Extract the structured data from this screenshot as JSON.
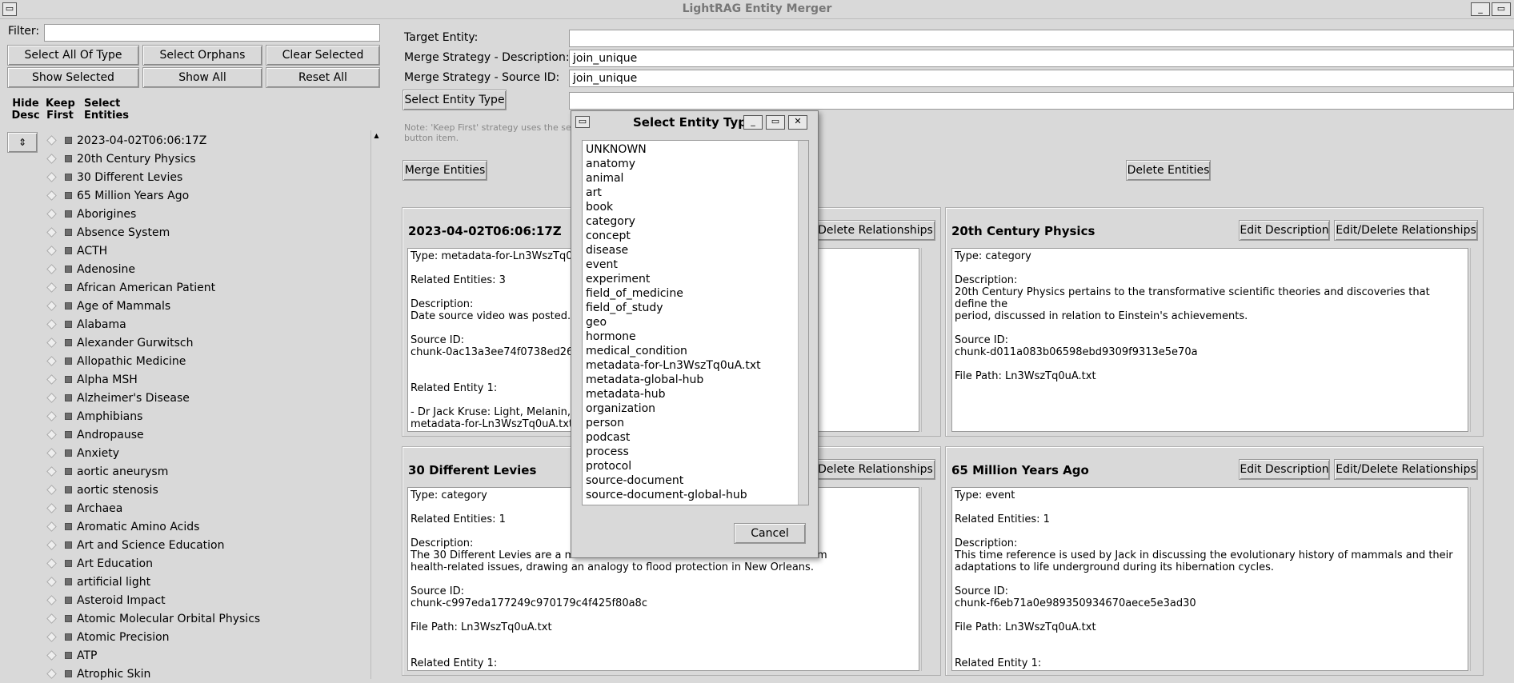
{
  "window": {
    "title": "LightRAG Entity Merger"
  },
  "filter": {
    "label": "Filter:",
    "value": ""
  },
  "left_buttons": {
    "select_all_of_type": "Select All Of Type",
    "select_orphans": "Select Orphans",
    "clear_selected": "Clear Selected",
    "show_selected": "Show Selected",
    "show_all": "Show All",
    "reset_all": "Reset All"
  },
  "columns": {
    "hide_desc": "Hide Desc",
    "keep_first": "Keep First",
    "select_entities": "Select Entities",
    "sort_glyph": "⇕"
  },
  "entities": [
    "2023-04-02T06:06:17Z",
    "20th Century Physics",
    "30 Different Levies",
    "65 Million Years Ago",
    "Aborigines",
    "Absence System",
    "ACTH",
    "Adenosine",
    "African American Patient",
    "Age of Mammals",
    "Alabama",
    "Alexander Gurwitsch",
    "Allopathic Medicine",
    "Alpha MSH",
    "Alzheimer's Disease",
    "Amphibians",
    "Andropause",
    "Anxiety",
    "aortic aneurysm",
    "aortic stenosis",
    "Archaea",
    "Aromatic Amino Acids",
    "Art and Science Education",
    "Art Education",
    "artificial light",
    "Asteroid Impact",
    "Atomic Molecular Orbital Physics",
    "Atomic Precision",
    "ATP",
    "Atrophic Skin"
  ],
  "form": {
    "target_entity_label": "Target Entity:",
    "target_entity_value": "",
    "merge_desc_label": "Merge Strategy - Description:",
    "merge_desc_value": "join_unique",
    "merge_source_label": "Merge Strategy - Source ID:",
    "merge_source_value": "join_unique",
    "select_entity_type_button": "Select Entity Type",
    "entity_type_value": "",
    "note_line1": "Note: 'Keep First' strategy uses the se",
    "note_line2": "button item.",
    "merge_button": "Merge Entities",
    "delete_button": "Delete Entities"
  },
  "panels": [
    {
      "title": "2023-04-02T06:06:17Z",
      "buttons": [
        "Delete Relationships"
      ],
      "text": "Type: metadata-for-Ln3WszTq0uA\n\nRelated Entities: 3\n\nDescription:\nDate source video was posted.\n\nSource ID:\nchunk-0ac13a3ee74f0738ed26f6\n\n\nRelated Entity 1:\n\n- Dr Jack Kruse: Light, Melanin, PO\nmetadata-for-Ln3WszTq0uA.txt)"
    },
    {
      "title": "20th Century Physics",
      "buttons": [
        "Edit Description",
        "Edit/Delete Relationships"
      ],
      "text": "Type: category\n\nDescription:\n20th Century Physics pertains to the transformative scientific theories and discoveries that define the\nperiod, discussed in relation to Einstein's achievements.\n\nSource ID:\nchunk-d011a083b06598ebd9309f9313e5e70a\n\nFile Path: Ln3WszTq0uA.txt"
    },
    {
      "title": "30 Different Levies",
      "buttons": [
        "Delete Relationships"
      ],
      "text": "Type: category\n\nRelated Entities: 1\n\nDescription:\nThe 30 Different Levies are a met                                                     ect him from\nhealth-related issues, drawing an analogy to flood protection in New Orleans.\n\nSource ID:\nchunk-c997eda177249c970179c4f425f80a8c\n\nFile Path: Ln3WszTq0uA.txt\n\n\nRelated Entity 1:"
    },
    {
      "title": "65 Million Years Ago",
      "buttons": [
        "Edit Description",
        "Edit/Delete Relationships"
      ],
      "text": "Type: event\n\nRelated Entities: 1\n\nDescription:\nThis time reference is used by Jack in discussing the evolutionary history of mammals and their\nadaptations to life underground during its hibernation cycles.\n\nSource ID:\nchunk-f6eb71a0e989350934670aece5e3ad30\n\nFile Path: Ln3WszTq0uA.txt\n\n\nRelated Entity 1:"
    }
  ],
  "dialog": {
    "title": "Select Entity Type",
    "items": [
      "UNKNOWN",
      "anatomy",
      "animal",
      "art",
      "book",
      "category",
      "concept",
      "disease",
      "event",
      "experiment",
      "field_of_medicine",
      "field_of_study",
      "geo",
      "hormone",
      "medical_condition",
      "metadata-for-Ln3WszTq0uA.txt",
      "metadata-global-hub",
      "metadata-hub",
      "organization",
      "person",
      "podcast",
      "process",
      "protocol",
      "source-document",
      "source-document-global-hub"
    ],
    "cancel": "Cancel"
  }
}
